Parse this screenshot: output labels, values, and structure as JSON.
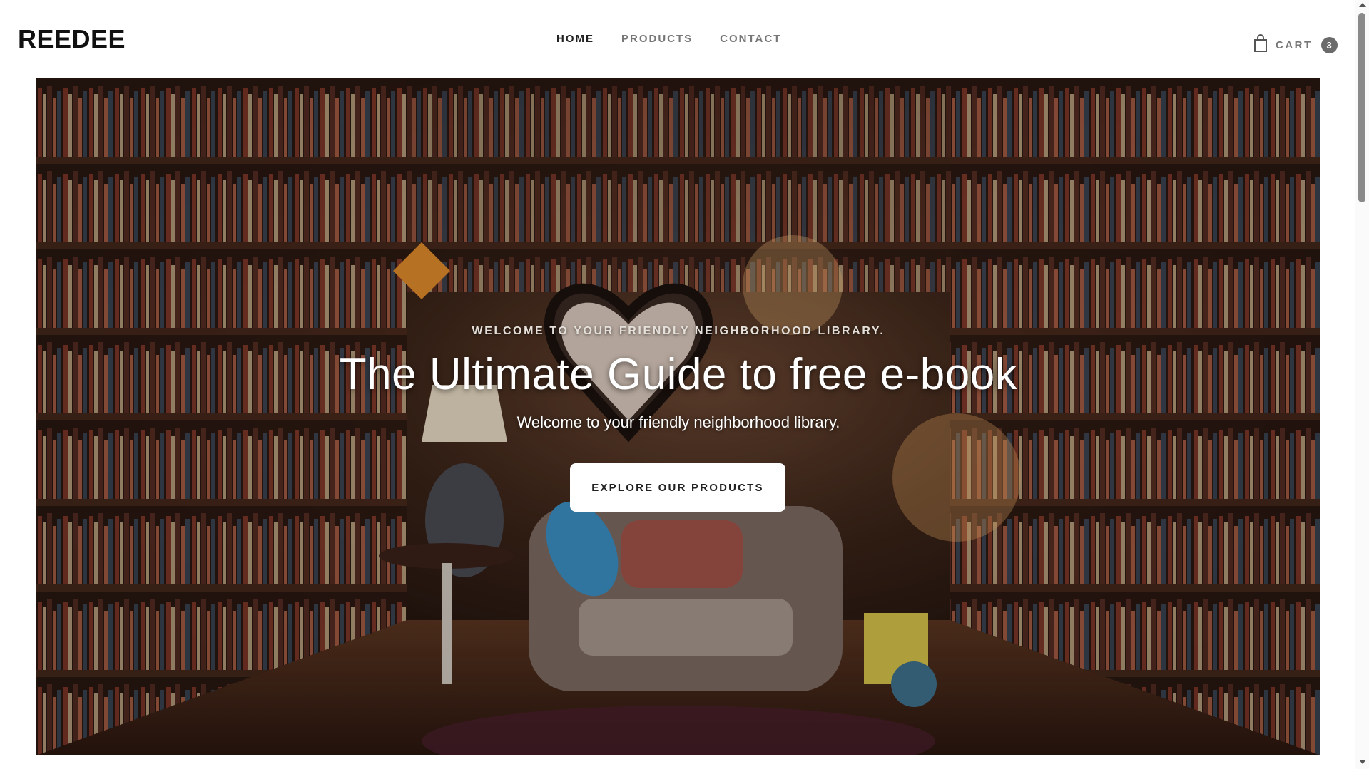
{
  "header": {
    "logo": "REEDEE",
    "nav": [
      {
        "label": "HOME",
        "active": true
      },
      {
        "label": "PRODUCTS",
        "active": false
      },
      {
        "label": "CONTACT",
        "active": false
      }
    ],
    "cart": {
      "label": "CART",
      "count": "3",
      "icon": "shopping-bag-icon"
    }
  },
  "hero": {
    "eyebrow": "WELCOME TO YOUR FRIENDLY NEIGHBORHOOD LIBRARY.",
    "title": "The Ultimate Guide to free e-book",
    "subtitle": "Welcome to your friendly neighborhood library.",
    "cta_label": "EXPLORE OUR PRODUCTS"
  },
  "colors": {
    "text_dark": "#222222",
    "nav_muted": "#777777",
    "badge_bg": "#6b6b6b",
    "cta_bg": "#ffffff"
  }
}
